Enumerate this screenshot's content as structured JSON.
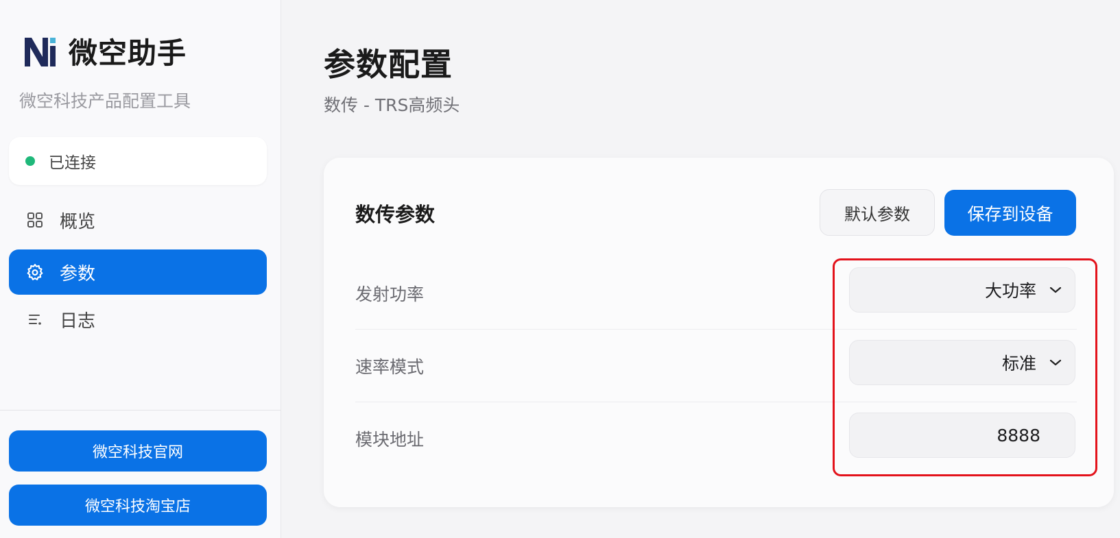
{
  "sidebar": {
    "brand_name": "微空助手",
    "brand_subtitle": "微空科技产品配置工具",
    "status": {
      "label": "已连接",
      "color": "#1fb87a"
    },
    "nav": [
      {
        "label": "概览",
        "icon": "grid-icon",
        "active": false
      },
      {
        "label": "参数",
        "icon": "gear-icon",
        "active": true
      },
      {
        "label": "日志",
        "icon": "list-icon",
        "active": false
      }
    ],
    "links": [
      {
        "label": "微空科技官网"
      },
      {
        "label": "微空科技淘宝店"
      }
    ]
  },
  "main": {
    "title": "参数配置",
    "subtitle": "数传 - TRS高频头",
    "card": {
      "title": "数传参数",
      "default_button": "默认参数",
      "save_button": "保存到设备",
      "params": [
        {
          "label": "发射功率",
          "value": "大功率",
          "type": "select"
        },
        {
          "label": "速率模式",
          "value": "标准",
          "type": "select"
        },
        {
          "label": "模块地址",
          "value": "8888",
          "type": "input"
        }
      ]
    }
  },
  "colors": {
    "accent": "#0a72e6",
    "highlight": "#e3121b"
  }
}
